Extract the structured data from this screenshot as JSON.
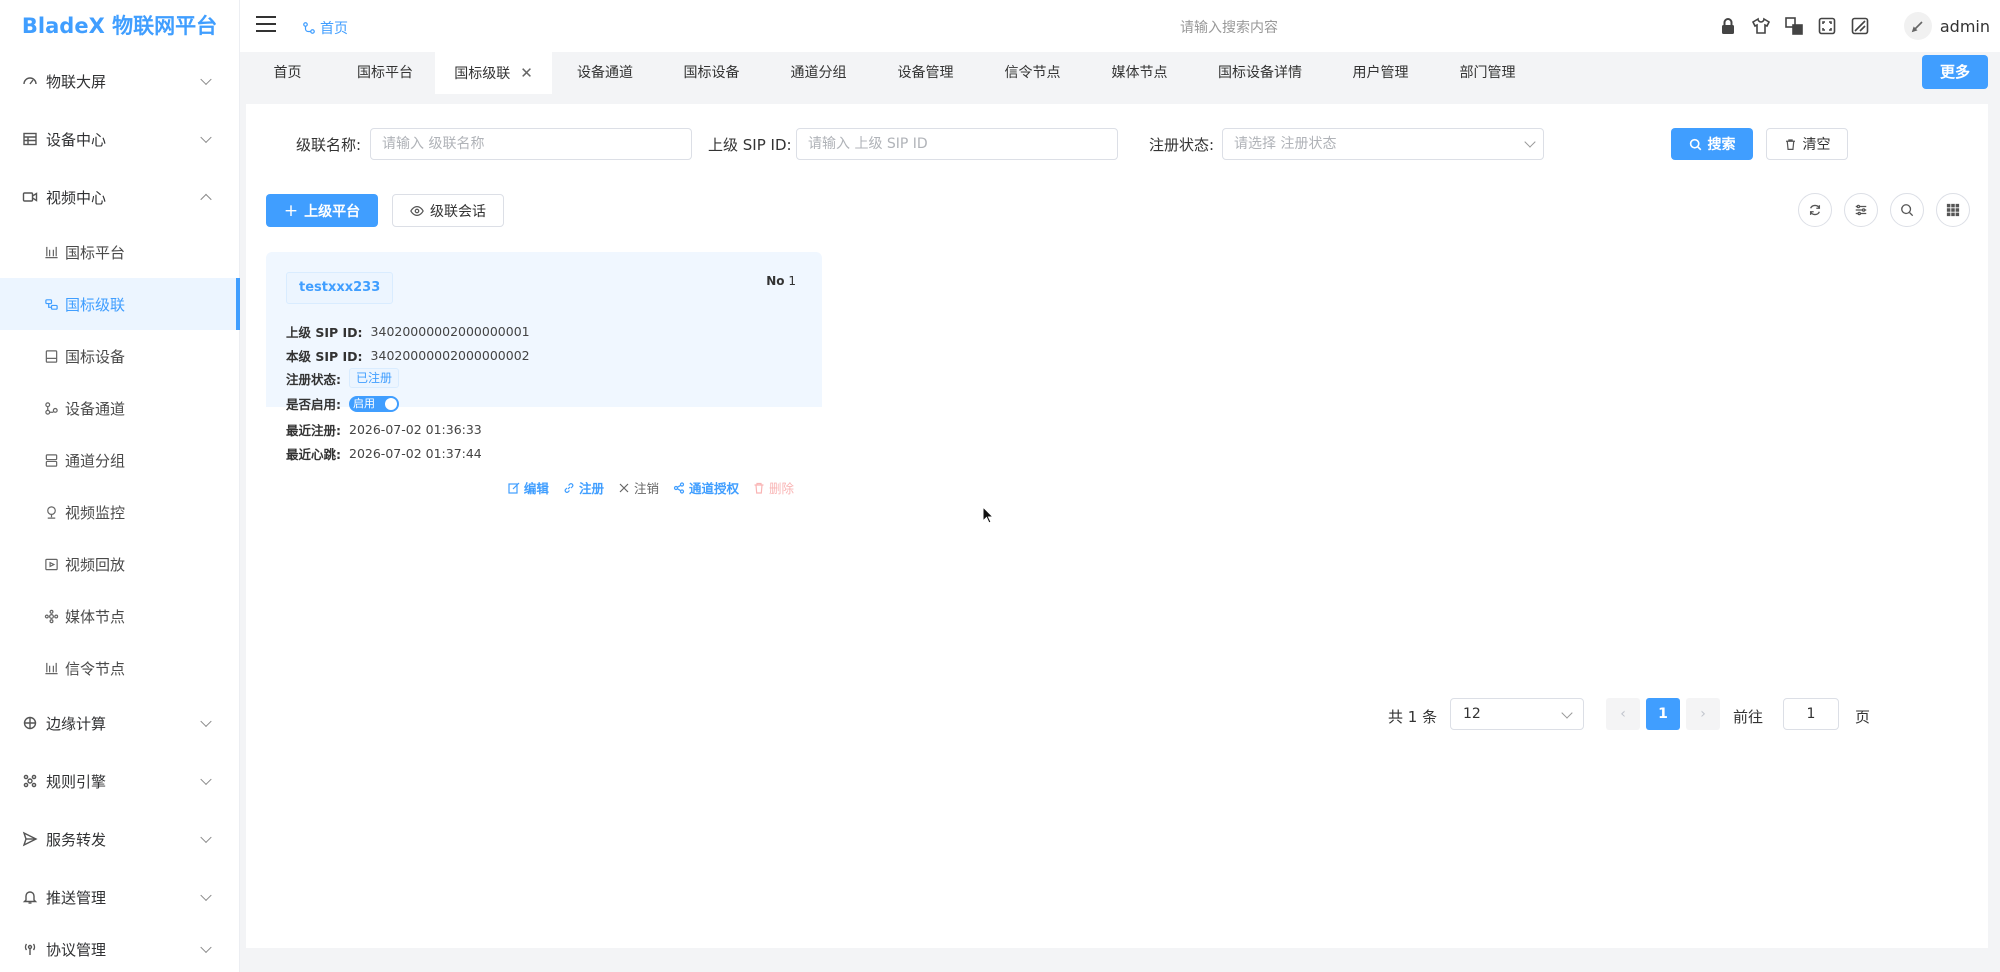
{
  "app": {
    "title": "BladeX 物联网平台"
  },
  "sidebar": {
    "items": [
      {
        "label": "物联大屏",
        "icon": "dashboard-icon",
        "expanded": false
      },
      {
        "label": "设备中心",
        "icon": "table-icon",
        "expanded": false
      },
      {
        "label": "视频中心",
        "icon": "video-camera-icon",
        "expanded": true
      },
      {
        "label": "边缘计算",
        "icon": "edge-compute-icon",
        "expanded": false
      },
      {
        "label": "规则引擎",
        "icon": "rules-icon",
        "expanded": false
      },
      {
        "label": "服务转发",
        "icon": "send-icon",
        "expanded": false
      },
      {
        "label": "推送管理",
        "icon": "bell-icon",
        "expanded": false
      },
      {
        "label": "协议管理",
        "icon": "protocol-icon",
        "expanded": false
      }
    ],
    "sub_items": [
      {
        "label": "国标平台",
        "icon": "platform-icon",
        "active": false
      },
      {
        "label": "国标级联",
        "icon": "cascade-icon",
        "active": true
      },
      {
        "label": "国标设备",
        "icon": "device-icon",
        "active": false
      },
      {
        "label": "设备通道",
        "icon": "channel-icon",
        "active": false
      },
      {
        "label": "通道分组",
        "icon": "group-icon",
        "active": false
      },
      {
        "label": "视频监控",
        "icon": "monitor-icon",
        "active": false
      },
      {
        "label": "视频回放",
        "icon": "playback-icon",
        "active": false
      },
      {
        "label": "媒体节点",
        "icon": "media-node-icon",
        "active": false
      },
      {
        "label": "信令节点",
        "icon": "signal-node-icon",
        "active": false
      }
    ]
  },
  "header": {
    "breadcrumb": "首页",
    "search_placeholder": "请输入搜索内容",
    "icons": [
      "lock-icon",
      "shirt-icon",
      "translate-icon",
      "fullscreen-icon",
      "theme-icon"
    ],
    "user": "admin"
  },
  "tabs": [
    {
      "label": "首页",
      "active": false
    },
    {
      "label": "国标平台",
      "active": false
    },
    {
      "label": "国标级联",
      "active": true,
      "closable": true
    },
    {
      "label": "设备通道",
      "active": false
    },
    {
      "label": "国标设备",
      "active": false
    },
    {
      "label": "通道分组",
      "active": false
    },
    {
      "label": "设备管理",
      "active": false
    },
    {
      "label": "信令节点",
      "active": false
    },
    {
      "label": "媒体节点",
      "active": false
    },
    {
      "label": "国标设备详情",
      "active": false
    },
    {
      "label": "用户管理",
      "active": false
    },
    {
      "label": "部门管理",
      "active": false
    }
  ],
  "more_label": "更多",
  "filters": {
    "name_label": "级联名称:",
    "name_placeholder": "请输入 级联名称",
    "sip_label": "上级 SIP ID:",
    "sip_placeholder": "请输入 上级 SIP ID",
    "status_label": "注册状态:",
    "status_placeholder": "请选择 注册状态",
    "search_btn": "搜索",
    "clear_btn": "清空"
  },
  "toolbar": {
    "add_btn": "上级平台",
    "session_btn": "级联会话",
    "tools": [
      "refresh-icon",
      "filter-columns-icon",
      "search-icon",
      "grid-icon"
    ]
  },
  "card": {
    "name": "testxxx233",
    "no_label": "No",
    "no_value": "1",
    "rows": {
      "parent_sip_label": "上级 SIP ID:",
      "parent_sip_value": "34020000002000000001",
      "local_sip_label": "本级 SIP ID:",
      "local_sip_value": "34020000002000000002",
      "status_label": "注册状态:",
      "status_value": "已注册",
      "enabled_label": "是否启用:",
      "enabled_value": "启用",
      "last_register_label": "最近注册:",
      "last_register_value": "2026-07-02 01:36:33",
      "last_heartbeat_label": "最近心跳:",
      "last_heartbeat_value": "2026-07-02 01:37:44"
    },
    "actions": {
      "edit": "编辑",
      "register": "注册",
      "unregister": "注销",
      "authorize": "通道授权",
      "delete": "删除"
    }
  },
  "pagination": {
    "total_text": "共 1 条",
    "page_size": "12",
    "current_page": "1",
    "goto_label": "前往",
    "goto_value": "1",
    "page_suffix": "页"
  },
  "colors": {
    "primary": "#409eff",
    "active_bg": "#ecf5ff",
    "danger_light": "#f9b4b4"
  }
}
